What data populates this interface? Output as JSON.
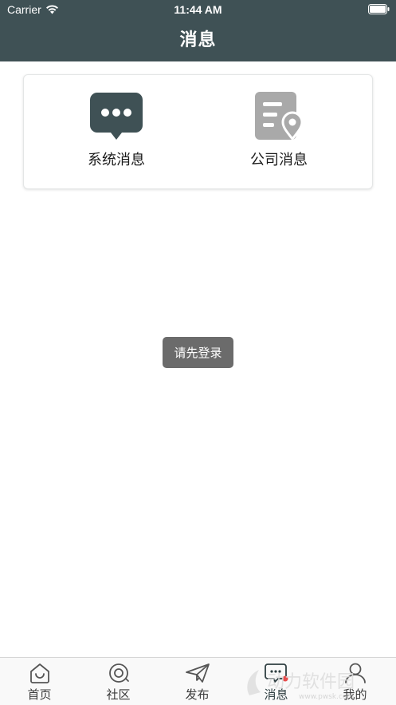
{
  "status_bar": {
    "carrier": "Carrier",
    "time": "11:44 AM"
  },
  "header": {
    "title": "消息",
    "background_color": "#3f5155"
  },
  "categories": [
    {
      "label": "系统消息",
      "icon": "chat-bubble-dots-icon",
      "color": "#3f5155"
    },
    {
      "label": "公司消息",
      "icon": "document-location-icon",
      "color": "#a9a9a9"
    }
  ],
  "toast": {
    "text": "请先登录"
  },
  "tabbar": {
    "active": "消息",
    "items": [
      {
        "label": "首页",
        "icon": "home-bag-icon"
      },
      {
        "label": "社区",
        "icon": "community-target-icon"
      },
      {
        "label": "发布",
        "icon": "paper-plane-icon"
      },
      {
        "label": "消息",
        "icon": "message-bubble-icon",
        "badge_color": "#e84c4c"
      },
      {
        "label": "我的",
        "icon": "person-icon"
      }
    ]
  },
  "watermark": {
    "text": "动力软件园",
    "url": "www.pwsk.com"
  }
}
